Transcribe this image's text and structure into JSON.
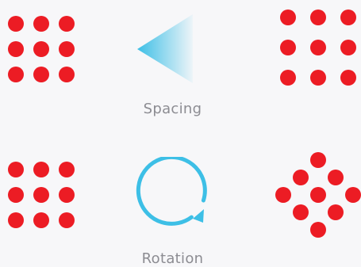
{
  "colors": {
    "background": "#f7f7f9",
    "dot": "#ec1c24",
    "accent": "#3dbfe6",
    "caption": "#8c8c92"
  },
  "panels": [
    {
      "caption": "Spacing",
      "from_pattern": "3x3 grid (tight)",
      "to_pattern": "3x3 grid (wide)",
      "icon": "funnel-arrow-icon"
    },
    {
      "caption": "Rotation",
      "from_pattern": "3x3 grid",
      "to_pattern": "3x3 grid rotated 45°",
      "icon": "rotate-clockwise-icon"
    }
  ]
}
